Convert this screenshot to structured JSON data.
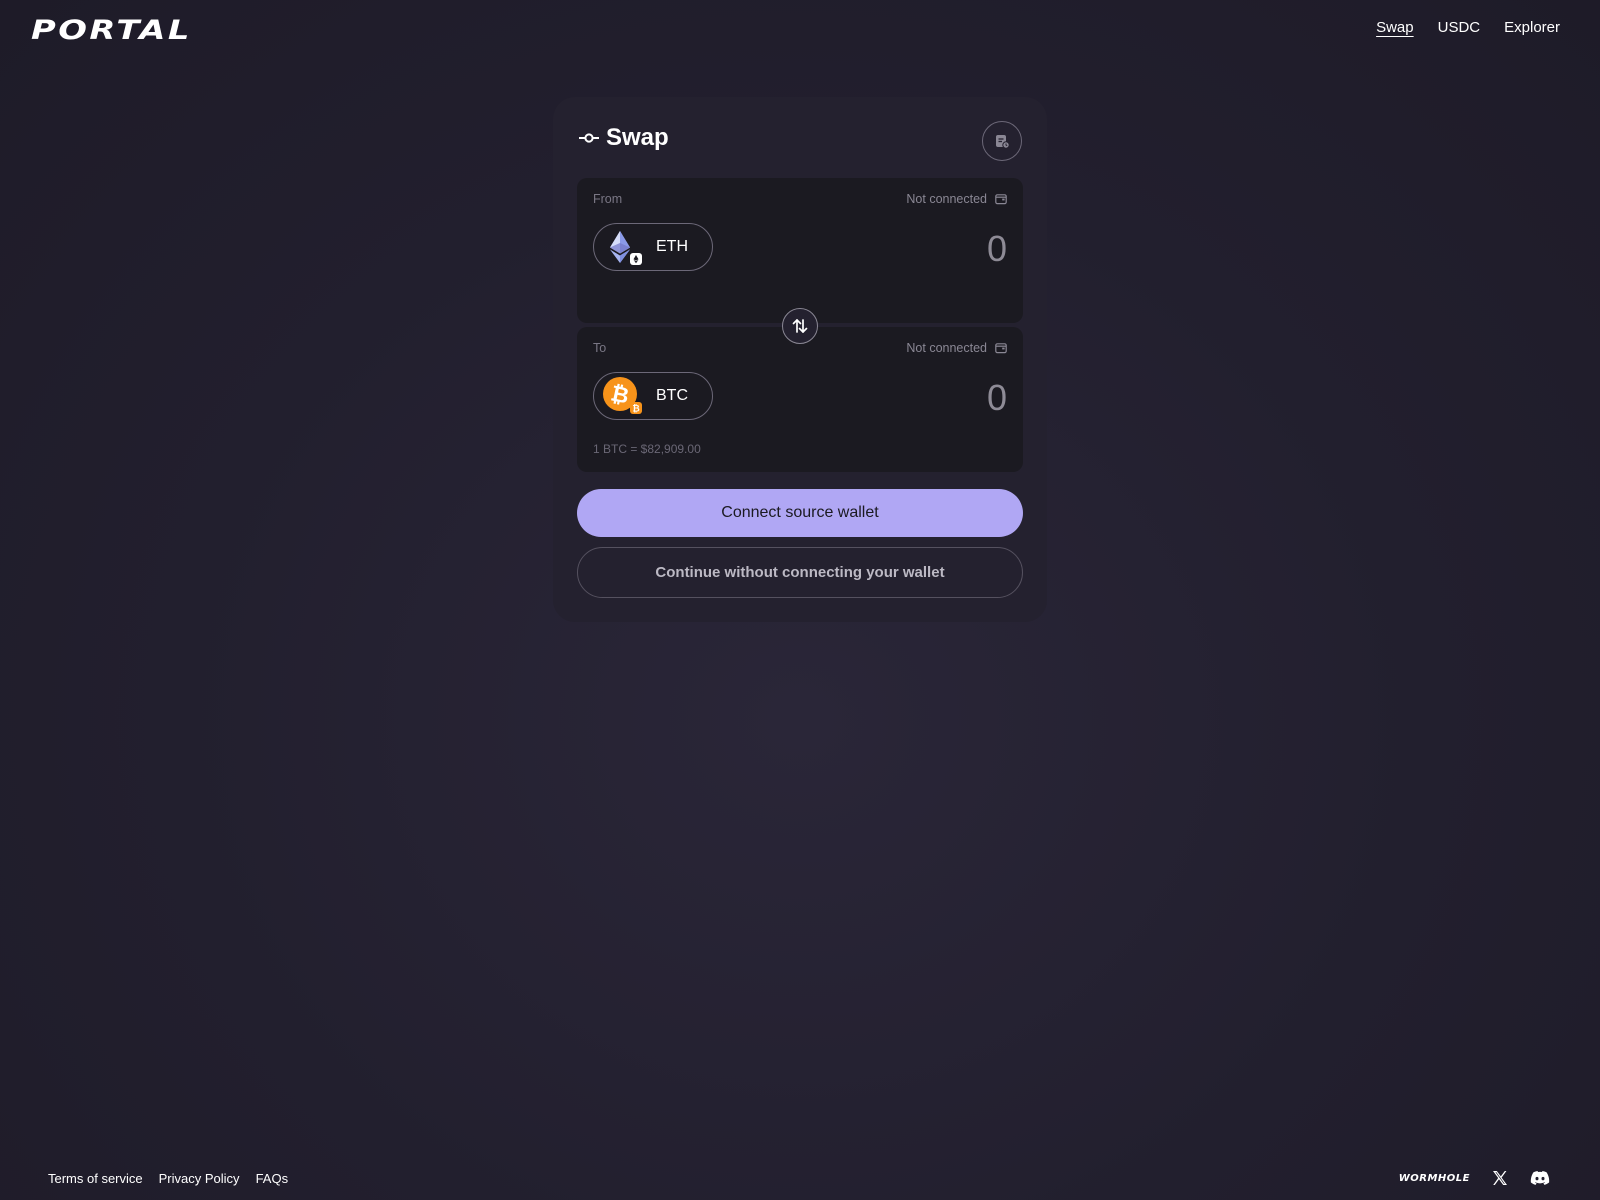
{
  "header": {
    "logo": "PORTAL",
    "nav": [
      "Swap",
      "USDC",
      "Explorer"
    ]
  },
  "card": {
    "title": "Swap",
    "icons": {
      "title": "commit-icon",
      "history": "receipt-clock-icon",
      "swap": "swap-vertical-icon"
    },
    "from": {
      "label": "From",
      "wallet_status": "Not connected",
      "token": "ETH",
      "amount": "0",
      "icon": "ethereum-icon"
    },
    "to": {
      "label": "To",
      "wallet_status": "Not connected",
      "token": "BTC",
      "amount": "0",
      "icon": "bitcoin-icon",
      "rate": "1 BTC = $82,909.00"
    },
    "primary_button": "Connect source wallet",
    "secondary_button": "Continue without connecting your wallet"
  },
  "footer": {
    "links": [
      "Terms of service",
      "Privacy Policy",
      "FAQs"
    ],
    "brand": "WORMHOLE",
    "social_icons": [
      "x-icon",
      "discord-icon"
    ]
  },
  "colors": {
    "background": "#221f2e",
    "card": "#24212f",
    "panel": "#1b1a21",
    "accent": "#b0a7f4",
    "bitcoin": "#f7931a"
  }
}
